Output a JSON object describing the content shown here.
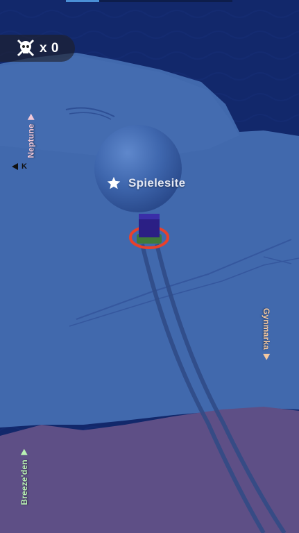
{
  "hud": {
    "kills_icon": "skull-crossbones-icon",
    "kill_count": "x 0"
  },
  "player": {
    "name": "Spielesite",
    "badge_icon": "star-icon"
  },
  "opponents": [
    {
      "name": "Neptune",
      "color": "#f2c8d8",
      "direction": "left-top"
    },
    {
      "name": "Gynmarka",
      "color": "#f5c9a0",
      "direction": "right"
    },
    {
      "name": "Breeze'den",
      "color": "#b9f2b4",
      "direction": "left-bottom"
    }
  ],
  "unnamed_indicator": {
    "label": "K",
    "arrow_icon": "arrow-left-icon",
    "color": "#111111"
  },
  "colors": {
    "sea": "#11276a",
    "ice": "#3f65a8",
    "purple_land": "#5d4e85",
    "snowball": "#3e66ad",
    "player_ring": "#e8412b",
    "player_body": "#2b1f85"
  },
  "top_progress": 0.2
}
